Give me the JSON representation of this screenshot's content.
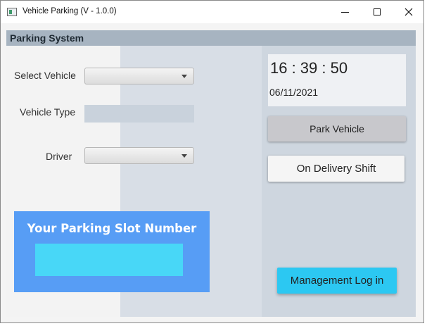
{
  "window": {
    "title": "Vehicle Parking (V - 1.0.0)"
  },
  "header": {
    "title": "Parking System"
  },
  "form": {
    "select_vehicle_label": "Select Vehicle",
    "select_vehicle_value": "",
    "vehicle_type_label": "Vehicle Type",
    "vehicle_type_value": "",
    "driver_label": "Driver",
    "driver_value": ""
  },
  "slot": {
    "title": "Your Parking Slot Number",
    "value": ""
  },
  "clock": {
    "time": "16 : 39 : 50",
    "date": "06/11/2021"
  },
  "buttons": {
    "park": "Park Vehicle",
    "delivery": "On Delivery Shift",
    "management": "Management Log in"
  },
  "colors": {
    "header_bar": "#a7b4c1",
    "slot_box": "#579df5",
    "slot_value": "#48d7f7",
    "management_button": "#2cc8f2"
  }
}
